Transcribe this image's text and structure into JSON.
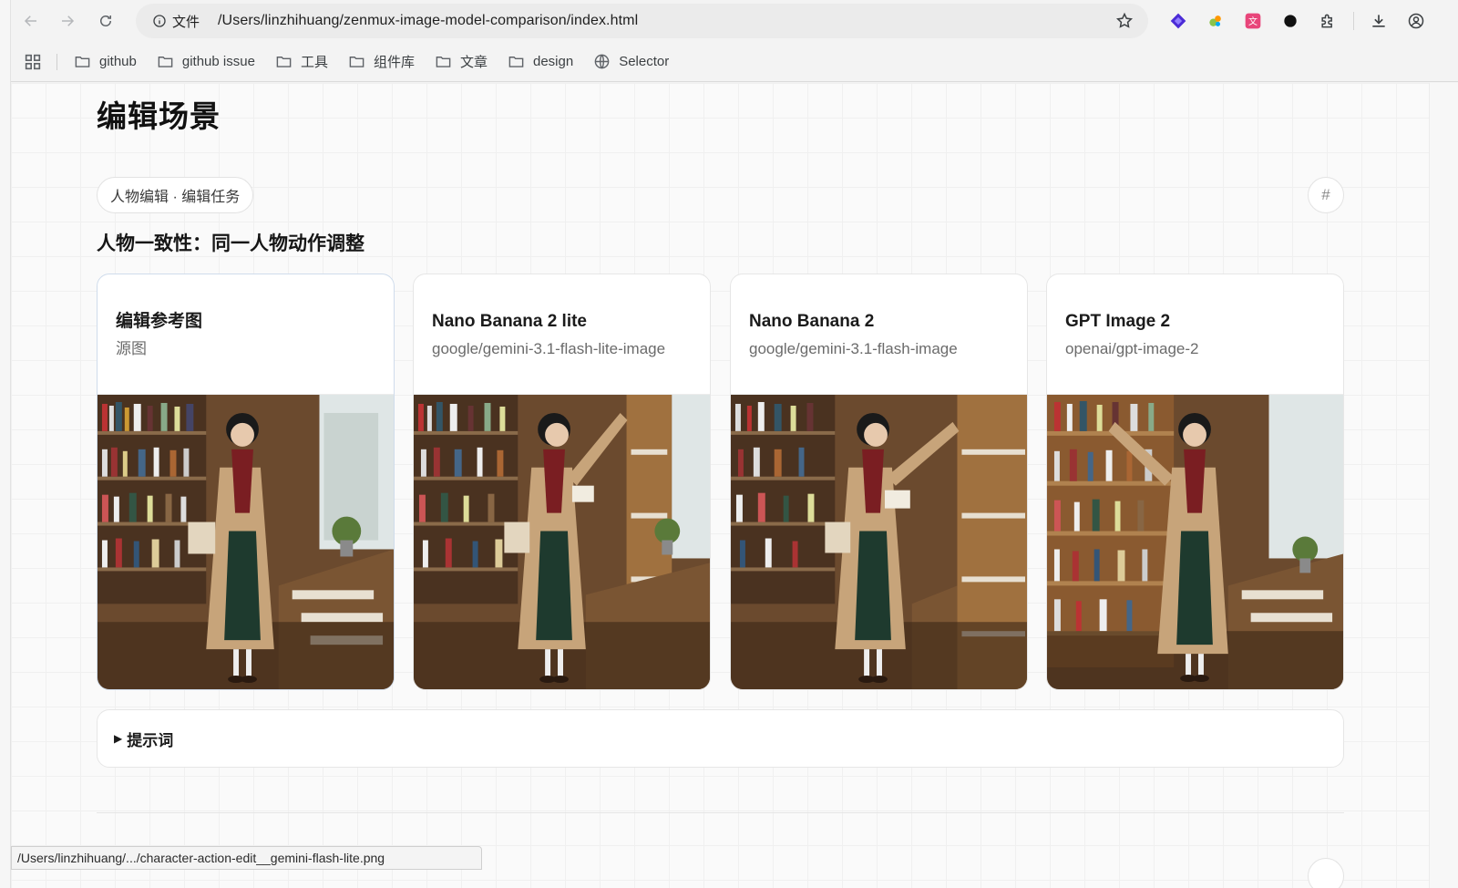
{
  "browser": {
    "omnibox": {
      "info_label": "文件",
      "url": "/Users/linzhihuang/zenmux-image-model-comparison/index.html"
    },
    "extensions": [
      "purple-diamond-icon",
      "colorful-extension-icon",
      "translate-icon",
      "black-circle-icon",
      "puzzle-icon"
    ],
    "bookmarks": [
      {
        "label": "github",
        "icon": "folder-icon"
      },
      {
        "label": "github issue",
        "icon": "folder-icon"
      },
      {
        "label": "工具",
        "icon": "folder-icon"
      },
      {
        "label": "组件库",
        "icon": "folder-icon"
      },
      {
        "label": "文章",
        "icon": "folder-icon"
      },
      {
        "label": "design",
        "icon": "folder-icon"
      },
      {
        "label": "Selector",
        "icon": "globe-icon"
      }
    ],
    "status_url": "/Users/linzhihuang/.../character-action-edit__gemini-flash-lite.png"
  },
  "page": {
    "section_title": "编辑场景",
    "chip_label": "人物编辑 · 编辑任务",
    "anchor_symbol": "#",
    "case_title": "人物一致性：同一人物动作调整",
    "cards": [
      {
        "name": "编辑参考图",
        "sub": "源图"
      },
      {
        "name": "Nano Banana 2 lite",
        "sub": "google/gemini-3.1-flash-lite-image"
      },
      {
        "name": "Nano Banana 2",
        "sub": "google/gemini-3.1-flash-image"
      },
      {
        "name": "GPT Image 2",
        "sub": "openai/gpt-image-2"
      }
    ],
    "prompt": {
      "arrow": "▶",
      "label": "提示词"
    }
  },
  "colors": {
    "page_bg": "#fafafa",
    "card_border": "#e6e6e6",
    "ref_card_border": "#cfdcec"
  }
}
